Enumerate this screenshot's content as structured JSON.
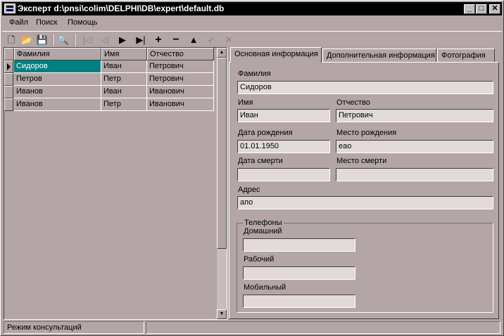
{
  "window": {
    "title": "Эксперт d:\\pnsi\\colim\\DELPHI\\DB\\expert\\default.db",
    "btn_min": "_",
    "btn_max": "□",
    "btn_close": "✕"
  },
  "menu": {
    "items": [
      "Файл",
      "Поиск",
      "Помощь"
    ]
  },
  "toolbar": {
    "icons": [
      "new-file-icon",
      "open-folder-icon",
      "save-icon",
      "search-refresh-icon",
      "nav-first-icon",
      "nav-prior-icon",
      "nav-next-icon",
      "nav-last-icon",
      "insert-icon",
      "delete-icon",
      "edit-icon",
      "post-icon",
      "cancel-icon"
    ],
    "glyphs": {
      "new": "🗋",
      "open": "📂",
      "save": "💾",
      "search": "🔍",
      "first": "|◁",
      "prior": "◁",
      "next": "▶",
      "last": "▶|",
      "insert": "+",
      "delete": "−",
      "edit": "▲",
      "post": "✓",
      "cancel": "✕"
    }
  },
  "grid": {
    "columns": [
      "Фамилия",
      "Имя",
      "Отчество"
    ],
    "rows": [
      [
        "Сидоров",
        "Иван",
        "Петрович"
      ],
      [
        "Петров",
        "Петр",
        "Петрович"
      ],
      [
        "Иванов",
        "Иван",
        "Иванович"
      ],
      [
        "Иванов",
        "Петр",
        "Иванович"
      ]
    ],
    "selected_row": 0,
    "scroll_up": "▲",
    "scroll_down": "▼"
  },
  "tabs": [
    "Основная информация",
    "Дополнительная информация",
    "Фотография"
  ],
  "form": {
    "surname_label": "Фамилия",
    "surname_value": "Сидоров",
    "name_label": "Имя",
    "name_value": "Иван",
    "patronymic_label": "Отчество",
    "patronymic_value": "Петрович",
    "birth_date_label": "Дата рождения",
    "birth_date_value": "01.01.1950",
    "birth_place_label": "Место рождения",
    "birth_place_value": "еао",
    "death_date_label": "Дата смерти",
    "death_date_value": "",
    "death_place_label": "Место смерти",
    "death_place_value": "",
    "address_label": "Адрес",
    "address_value": "апо",
    "phones_group_label": "Телефоны",
    "home_label": "Домашний",
    "home_value": "",
    "work_label": "Рабочий",
    "work_value": "",
    "mobile_label": "Мобильный",
    "mobile_value": ""
  },
  "status": {
    "mode": "Режим консультаций",
    "panel2": ""
  },
  "colors": {
    "face": "#b4a6a6",
    "field": "#e2dada",
    "selection": "#008080",
    "titlebar": "#000000"
  }
}
